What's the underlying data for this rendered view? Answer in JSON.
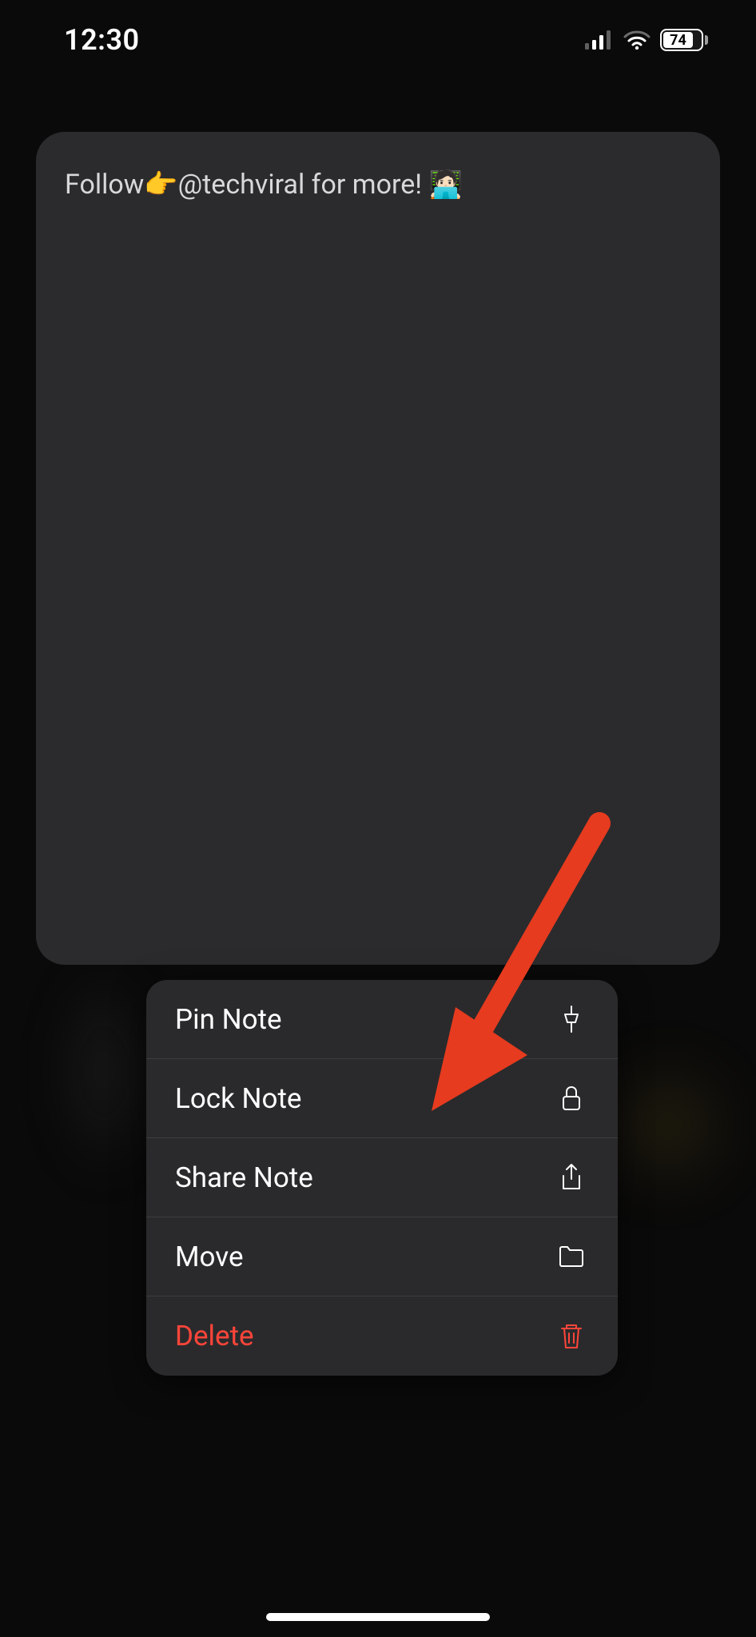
{
  "status_bar": {
    "time": "12:30",
    "battery_percent": "74"
  },
  "note": {
    "content": "Follow👉@techviral for more! 🧑🏻‍💻"
  },
  "menu": {
    "items": [
      {
        "label": "Pin Note",
        "icon": "pin-icon",
        "destructive": false
      },
      {
        "label": "Lock Note",
        "icon": "lock-icon",
        "destructive": false
      },
      {
        "label": "Share Note",
        "icon": "share-icon",
        "destructive": false
      },
      {
        "label": "Move",
        "icon": "folder-icon",
        "destructive": false
      },
      {
        "label": "Delete",
        "icon": "trash-icon",
        "destructive": true
      }
    ]
  },
  "annotation": {
    "arrow_color": "#e63b1f"
  }
}
